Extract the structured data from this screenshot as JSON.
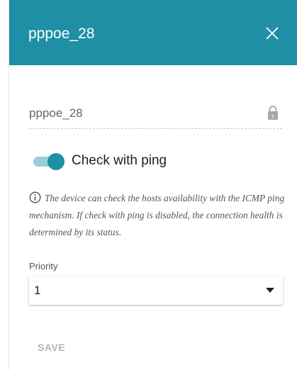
{
  "header": {
    "title": "pppoe_28"
  },
  "name_field": {
    "value": "pppoe_28"
  },
  "ping_toggle": {
    "label": "Check with ping",
    "enabled": true
  },
  "info": {
    "text": "The device can check the hosts availability with the ICMP ping mechanism. If check with ping is disabled, the connection health is determined by its status."
  },
  "priority": {
    "label": "Priority",
    "selected": "1"
  },
  "actions": {
    "save_label": "SAVE"
  },
  "colors": {
    "header_bg": "#1f8fa6",
    "toggle_on": "#1f8fa6",
    "toggle_track": "#93cfdc",
    "disabled_text": "#b5b5b5"
  },
  "icons": {
    "close": "close-icon",
    "lock": "lock-icon",
    "info": "info-icon",
    "caret": "caret-down-icon"
  }
}
